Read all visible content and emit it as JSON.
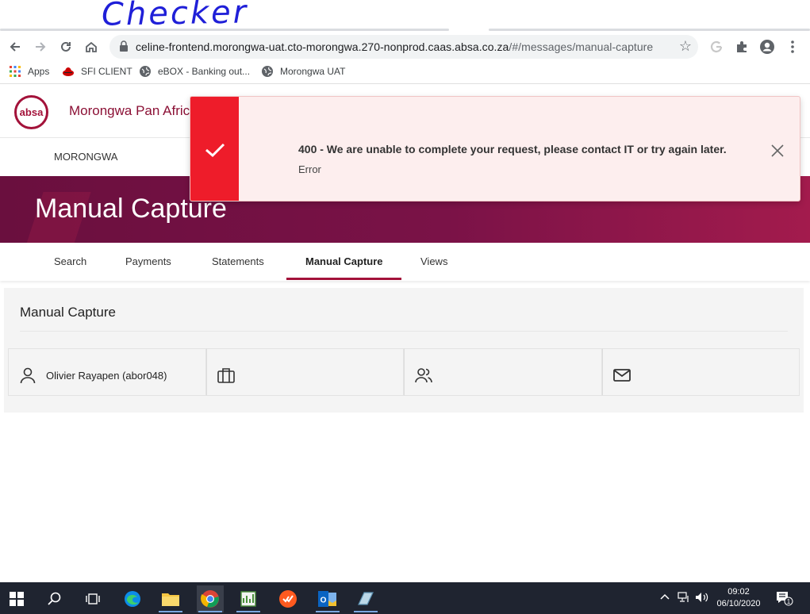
{
  "annotation": {
    "text": "Checker"
  },
  "browser": {
    "url_host": "celine-frontend.morongwa-uat.cto-morongwa.270-nonprod.caas.absa.co.za",
    "url_path": "/#/messages/manual-capture",
    "bookmarks": [
      {
        "label": "Apps",
        "icon": "apps-grid-icon"
      },
      {
        "label": "SFI CLIENT",
        "icon": "redhat-icon"
      },
      {
        "label": "eBOX - Banking out...",
        "icon": "globe-icon"
      },
      {
        "label": "Morongwa UAT",
        "icon": "globe-icon"
      }
    ]
  },
  "app": {
    "logo_text": "absa",
    "brand": "Morongwa Pan Africa",
    "org": "MORONGWA",
    "banner_title": "Manual Capture",
    "brand_color": "#a3123a"
  },
  "nav": {
    "tabs": [
      {
        "label": "Search"
      },
      {
        "label": "Payments"
      },
      {
        "label": "Statements"
      },
      {
        "label": "Manual Capture",
        "active": true
      },
      {
        "label": "Views"
      }
    ]
  },
  "content": {
    "title": "Manual Capture",
    "user": "Olivier Rayapen (abor048)",
    "cards": [
      {
        "icon": "user-icon"
      },
      {
        "icon": "briefcase-icon"
      },
      {
        "icon": "users-icon"
      },
      {
        "icon": "mail-icon"
      }
    ]
  },
  "toast": {
    "message": "400 - We are unable to complete your request, please contact IT or try again later.",
    "subtitle": "Error",
    "side_color": "#ee1c2a"
  },
  "taskbar": {
    "time": "09:02",
    "date": "06/10/2020",
    "notifications": "1"
  }
}
